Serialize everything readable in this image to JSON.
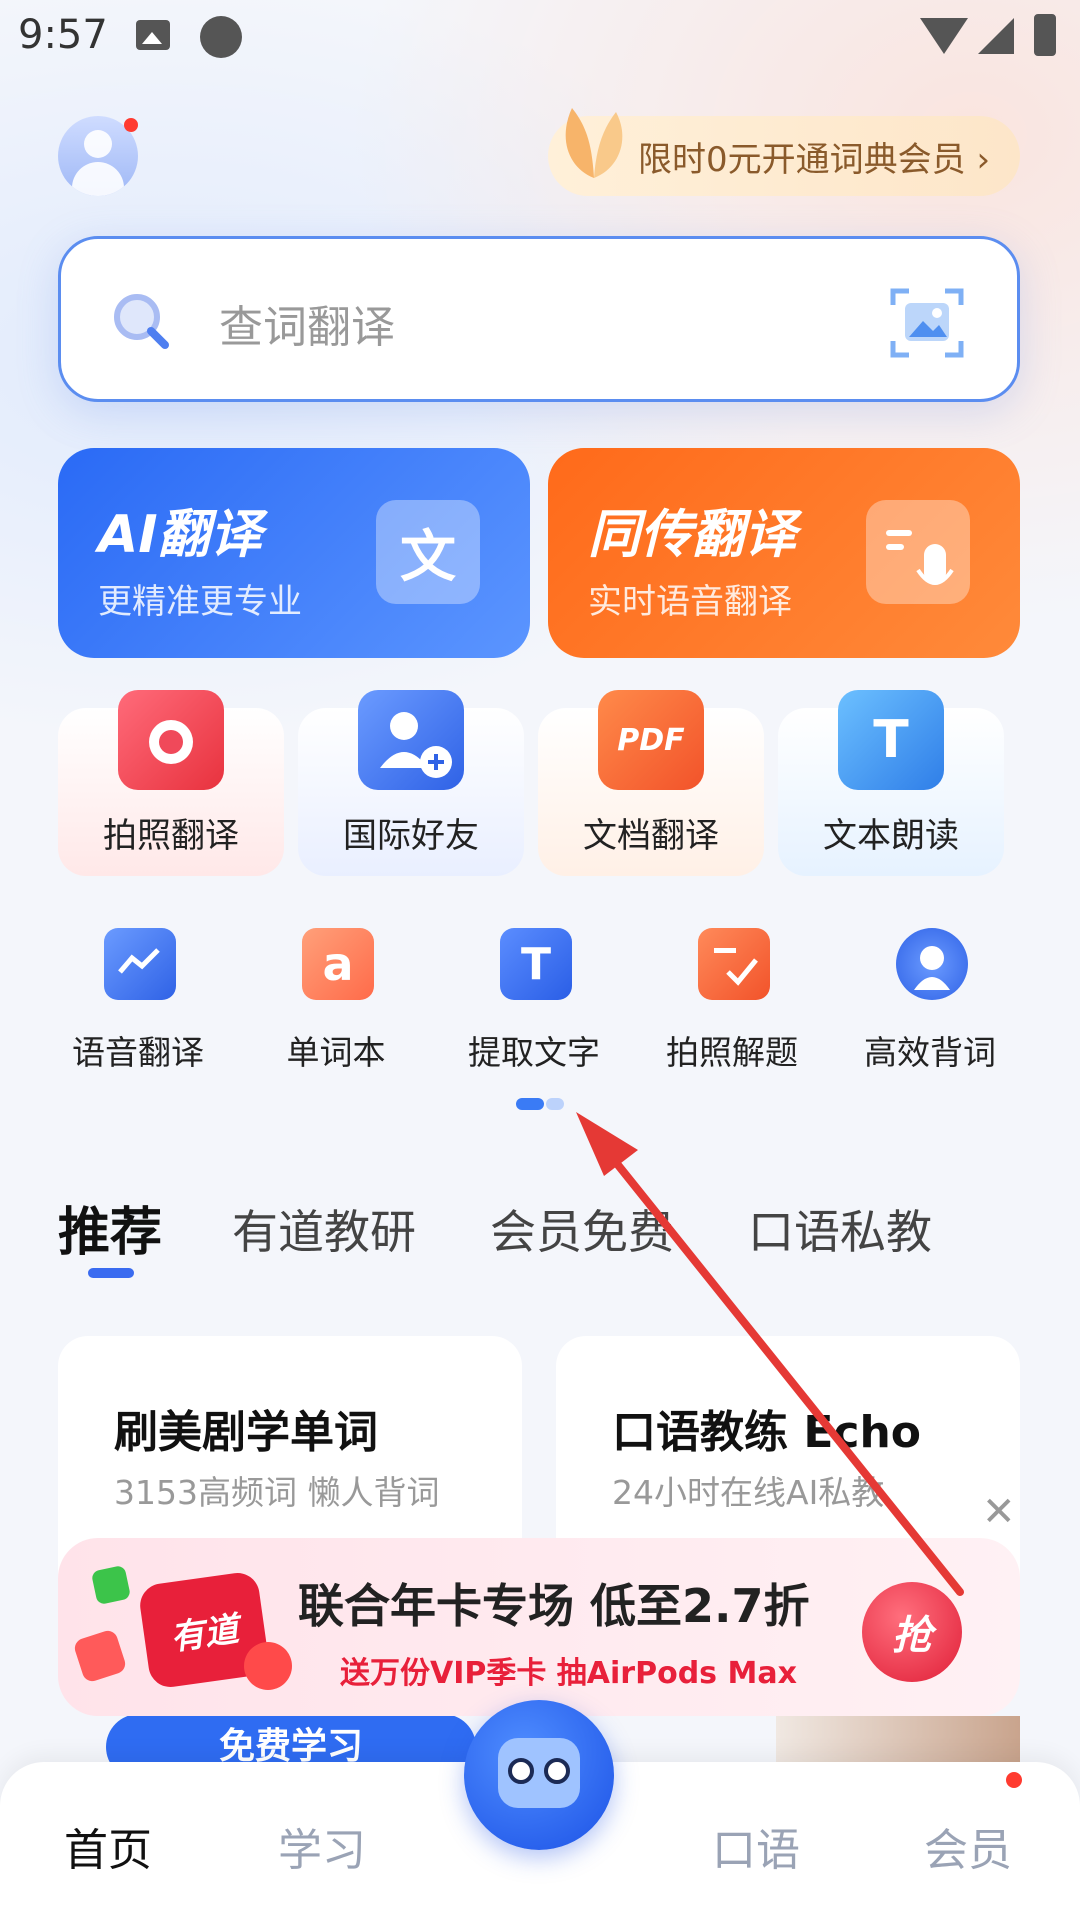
{
  "status_bar": {
    "time": "9:57"
  },
  "header": {
    "promo_text": "限时0元开通词典会员 ›"
  },
  "search": {
    "placeholder": "查词翻译"
  },
  "big_cards": [
    {
      "title": "AI翻译",
      "subtitle": "更精准更专业",
      "icon_text": "文"
    },
    {
      "title": "同传翻译",
      "subtitle": "实时语音翻译"
    }
  ],
  "mid_tools": [
    {
      "label": "拍照翻译"
    },
    {
      "label": "国际好友"
    },
    {
      "label": "文档翻译",
      "icon_text": "PDF"
    },
    {
      "label": "文本朗读",
      "icon_text": "T"
    }
  ],
  "small_tools": [
    {
      "label": "语音翻译"
    },
    {
      "label": "单词本",
      "icon_text": "a"
    },
    {
      "label": "提取文字",
      "icon_text": "T"
    },
    {
      "label": "拍照解题"
    },
    {
      "label": "高效背词"
    }
  ],
  "tabs": [
    {
      "label": "推荐"
    },
    {
      "label": "有道教研"
    },
    {
      "label": "会员免费"
    },
    {
      "label": "口语私教"
    }
  ],
  "cards": [
    {
      "title": "刷美剧学单词",
      "subtitle": "3153高频词 懒人背词"
    },
    {
      "title": "口语教练 Echo",
      "subtitle": "24小时在线AI私教"
    }
  ],
  "banner": {
    "logo_text": "有道",
    "title": "联合年卡专场 低至2.7折",
    "subtitle": "送万份VIP季卡 抽AirPods Max",
    "button": "抢"
  },
  "free_study": "免费学习",
  "nav": {
    "items": [
      "首页",
      "学习",
      "口语",
      "会员"
    ]
  },
  "colors": {
    "accent": "#3a6bf0",
    "orange": "#ff6a1a",
    "red": "#e8203a",
    "arrow": "#e53935"
  }
}
